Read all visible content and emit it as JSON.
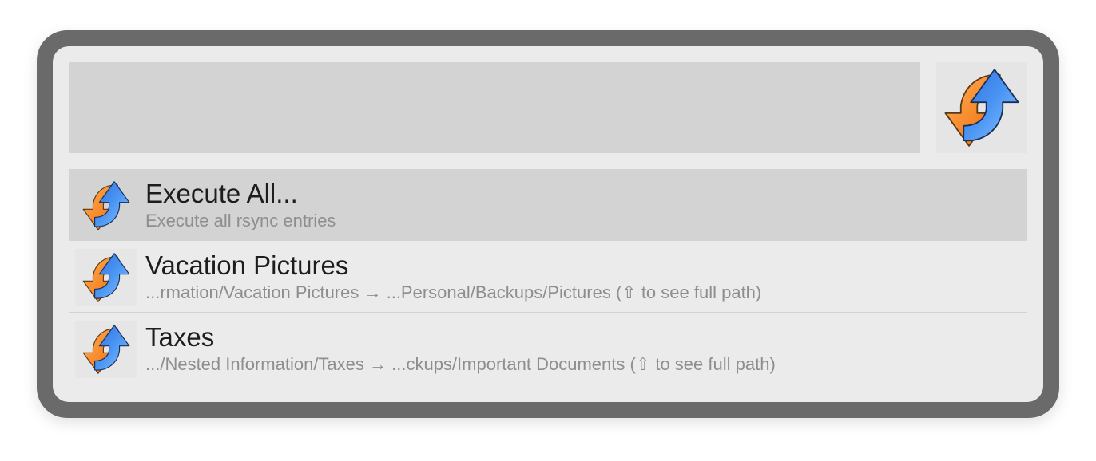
{
  "search": {
    "value": "",
    "placeholder": ""
  },
  "workflow": {
    "icon": "sync-arrows-icon"
  },
  "results": [
    {
      "title": "Execute All...",
      "subtitle": "Execute all rsync entries",
      "icon": "sync-arrows-icon",
      "selected": true
    },
    {
      "title": "Vacation Pictures",
      "subtitle": "...rmation/Vacation Pictures → ...Personal/Backups/Pictures (⇧ to see full path)",
      "icon": "sync-arrows-icon",
      "selected": false
    },
    {
      "title": "Taxes",
      "subtitle": ".../Nested Information/Taxes → ...ckups/Important Documents (⇧ to see full path)",
      "icon": "sync-arrows-icon",
      "selected": false
    }
  ],
  "colors": {
    "frame": "#6a6a6a",
    "panel": "#ebebeb",
    "search_bg": "#d3d3d3",
    "selected_row": "#d3d3d3",
    "arrow_orange": "#f7892a",
    "arrow_blue": "#3f8ef0"
  }
}
